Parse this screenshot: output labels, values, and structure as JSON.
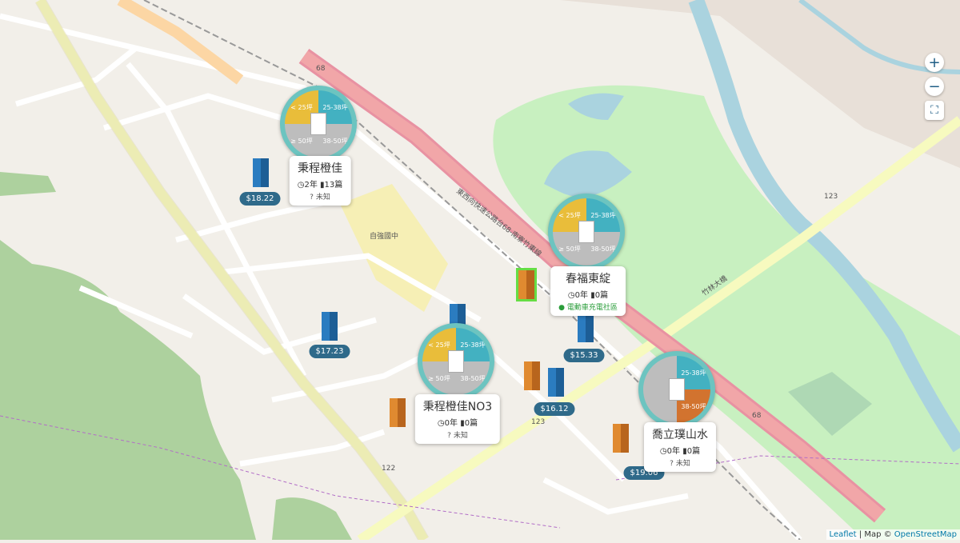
{
  "map": {
    "road_labels": {
      "r68_a": "68",
      "r68_b": "68",
      "r123_a": "123",
      "r123_b": "123",
      "r122": "122",
      "school": "自強國中",
      "expressway": "東西向快速公路台68-南寮竹東線",
      "bridge": "竹林大橋"
    }
  },
  "prices": [
    "$18.22",
    "$17.23",
    "$15.33",
    "$16.12",
    "$19.06"
  ],
  "clusters": [
    {
      "name": "秉程橙佳",
      "years": "2年",
      "articles": "13篇",
      "status": "未知",
      "status_green": false,
      "q_tl": "< 25坪",
      "q_tr": "25-38坪",
      "q_bl": "≥ 50坪",
      "q_br": "38-50坪",
      "colors": {
        "tl": "#e9bd3a",
        "tr": "#43b1c1",
        "bl": "#bdbdbd",
        "br": "#bdbdbd"
      }
    },
    {
      "name": "春福東綻",
      "years": "0年",
      "articles": "0篇",
      "status": "電動車充電社區",
      "status_green": true,
      "q_tl": "< 25坪",
      "q_tr": "25-38坪",
      "q_bl": "≥ 50坪",
      "q_br": "38-50坪",
      "colors": {
        "tl": "#e9bd3a",
        "tr": "#43b1c1",
        "bl": "#bdbdbd",
        "br": "#bdbdbd"
      }
    },
    {
      "name": "秉程橙佳NO3",
      "years": "0年",
      "articles": "0篇",
      "status": "未知",
      "status_green": false,
      "q_tl": "< 25坪",
      "q_tr": "25-38坪",
      "q_bl": "≥ 50坪",
      "q_br": "38-50坪",
      "colors": {
        "tl": "#e9bd3a",
        "tr": "#43b1c1",
        "bl": "#bdbdbd",
        "br": "#bdbdbd"
      }
    },
    {
      "name": "喬立璞山水",
      "years": "0年",
      "articles": "0篇",
      "status": "未知",
      "status_green": false,
      "q_tl": "",
      "q_tr": "25-38坪",
      "q_bl": "",
      "q_br": "38-50坪",
      "colors": {
        "tl": "#bdbdbd",
        "tr": "#43b1c1",
        "bl": "#bdbdbd",
        "br": "#d2732f"
      }
    }
  ],
  "controls": {
    "zoom_in": "+",
    "zoom_out": "−",
    "fullscreen": "⛶"
  },
  "attribution": {
    "leaflet": "Leaflet",
    "sep": " | Map © ",
    "osm": "OpenStreetMap"
  }
}
